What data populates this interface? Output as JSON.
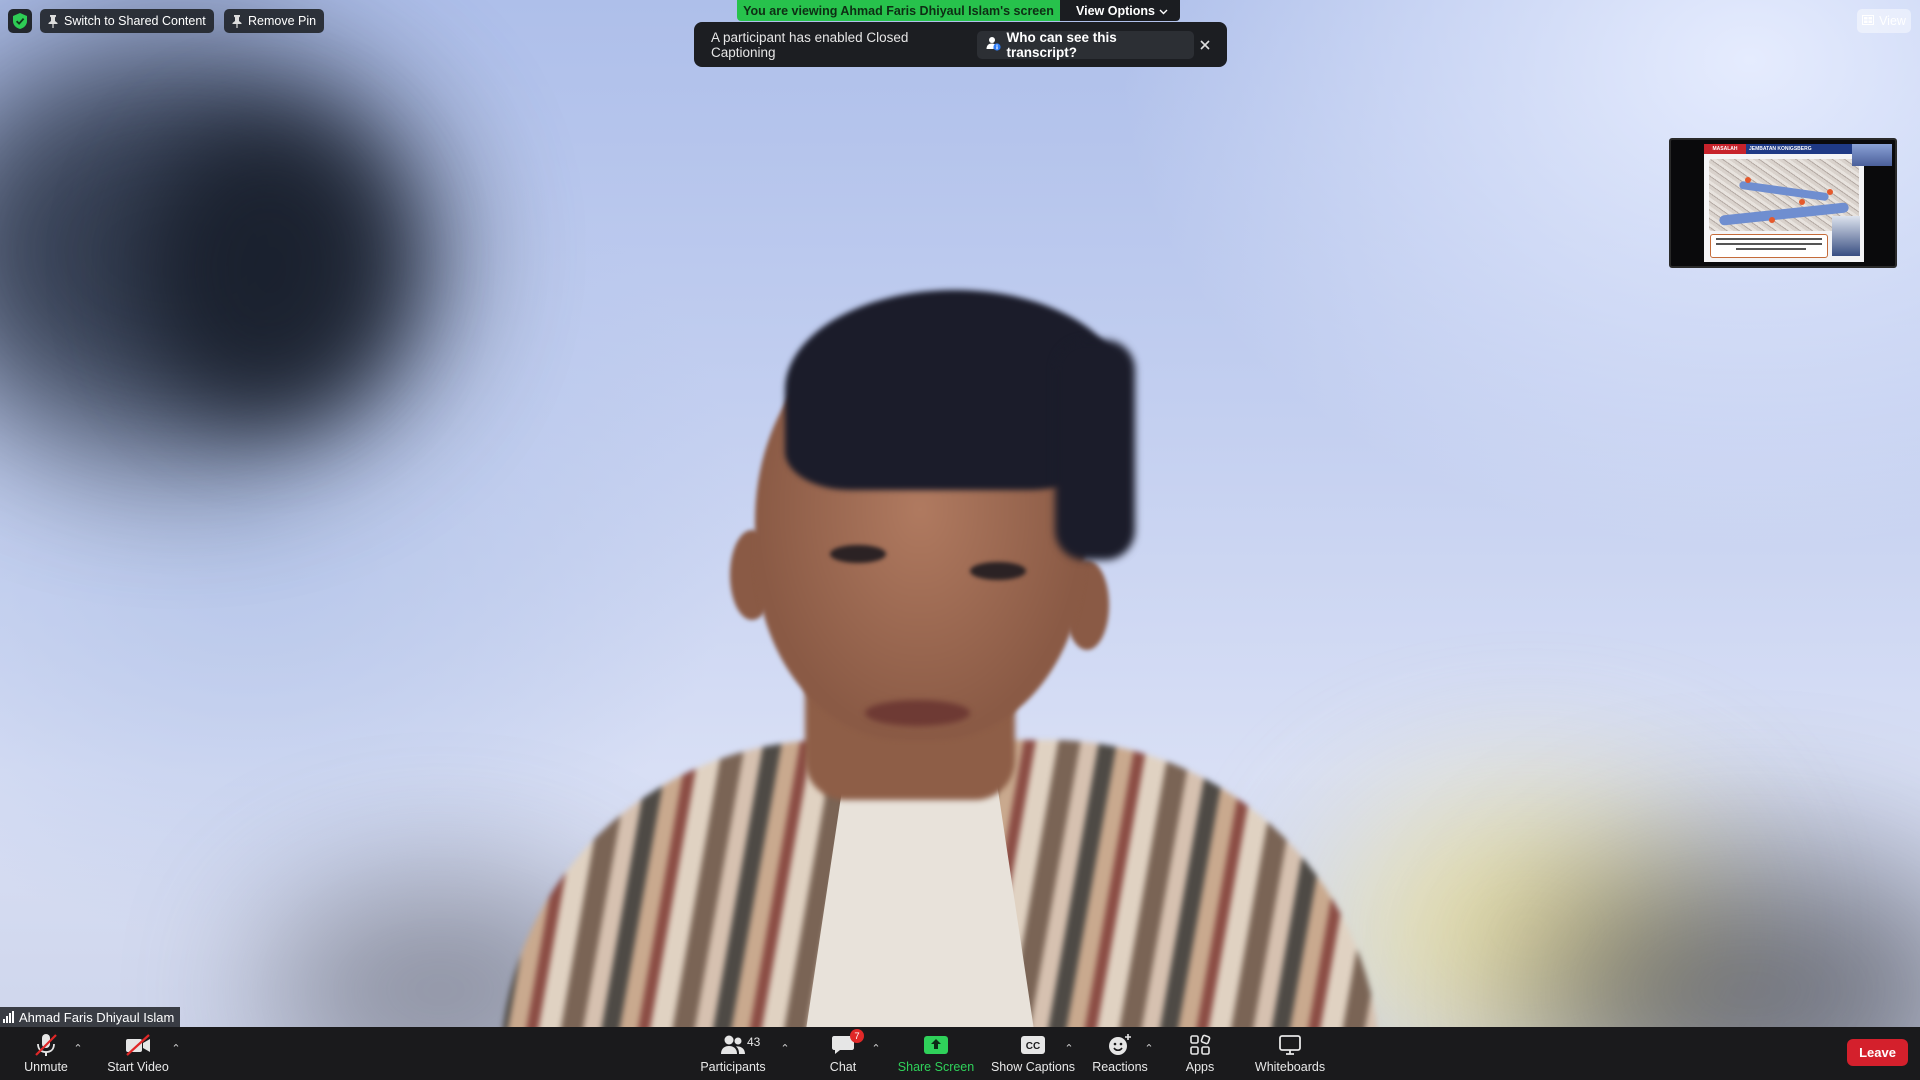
{
  "top_left": {
    "switch_label": "Switch to Shared Content",
    "remove_pin_label": "Remove Pin"
  },
  "banner": {
    "viewing_text": "You are viewing Ahmad Faris Dhiyaul Islam's screen",
    "view_options_label": "View Options"
  },
  "caption_toast": {
    "message": "A participant has enabled Closed Captioning",
    "who_label": "Who can see this transcript?"
  },
  "top_right": {
    "view_label": "View"
  },
  "thumbnail": {
    "slide_tag": "MASALAH",
    "slide_title": "JEMBATAN KONIGSBERG"
  },
  "video": {
    "participant_name": "Ahmad Faris Dhiyaul Islam"
  },
  "toolbar": {
    "unmute_label": "Unmute",
    "start_video_label": "Start Video",
    "participants_label": "Participants",
    "participants_count": "43",
    "chat_label": "Chat",
    "chat_badge": "7",
    "share_label": "Share Screen",
    "captions_label": "Show Captions",
    "captions_icon_text": "CC",
    "reactions_label": "Reactions",
    "apps_label": "Apps",
    "whiteboards_label": "Whiteboards",
    "leave_label": "Leave"
  },
  "colors": {
    "banner_green": "#27c24c",
    "leave_red": "#d4202c",
    "share_green": "#2fd15a",
    "toolbar_bg": "#1a1a1c"
  }
}
